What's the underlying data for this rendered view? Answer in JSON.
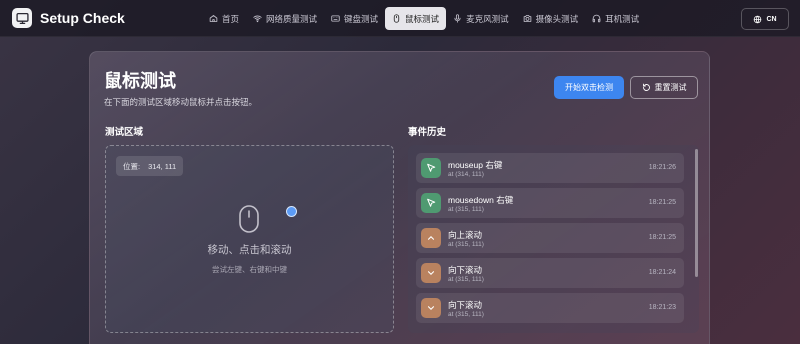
{
  "app": {
    "title": "Setup Check"
  },
  "nav": {
    "tabs": [
      {
        "label": "首页",
        "icon": "home-icon",
        "active": false
      },
      {
        "label": "网络质量测试",
        "icon": "wifi-icon",
        "active": false
      },
      {
        "label": "键盘测试",
        "icon": "keyboard-icon",
        "active": false
      },
      {
        "label": "鼠标测试",
        "icon": "mouse-icon",
        "active": true
      },
      {
        "label": "麦克风测试",
        "icon": "microphone-icon",
        "active": false
      },
      {
        "label": "摄像头测试",
        "icon": "camera-icon",
        "active": false
      },
      {
        "label": "耳机测试",
        "icon": "headphones-icon",
        "active": false
      }
    ],
    "language": "CN"
  },
  "page": {
    "title": "鼠标测试",
    "subtitle": "在下面的测试区域移动鼠标并点击按钮。",
    "start_button": "开始双击检测",
    "reset_button": "重置测试"
  },
  "test_area": {
    "heading": "测试区域",
    "position_label": "位置:",
    "position_value": "314, 111",
    "main_text": "移动、点击和滚动",
    "hint_text": "尝试左键、右键和中键"
  },
  "events": {
    "heading": "事件历史",
    "items": [
      {
        "title": "mouseup 右键",
        "coords": "at (314, 111)",
        "time": "18:21:26",
        "color": "green",
        "icon": "cursor-arrow-icon"
      },
      {
        "title": "mousedown 右键",
        "coords": "at (315, 111)",
        "time": "18:21:25",
        "color": "green",
        "icon": "cursor-arrow-icon"
      },
      {
        "title": "向上滚动",
        "coords": "at (315, 111)",
        "time": "18:21:25",
        "color": "orange",
        "icon": "chevron-up-icon"
      },
      {
        "title": "向下滚动",
        "coords": "at (315, 111)",
        "time": "18:21:24",
        "color": "orange",
        "icon": "chevron-down-icon"
      },
      {
        "title": "向下滚动",
        "coords": "at (315, 111)",
        "time": "18:21:23",
        "color": "orange",
        "icon": "chevron-down-icon"
      }
    ]
  },
  "colors": {
    "accent": "#3d86f0",
    "event_green": "#4f9a71",
    "event_orange": "#b9825f",
    "cursor_dot": "#5c9bf5"
  }
}
